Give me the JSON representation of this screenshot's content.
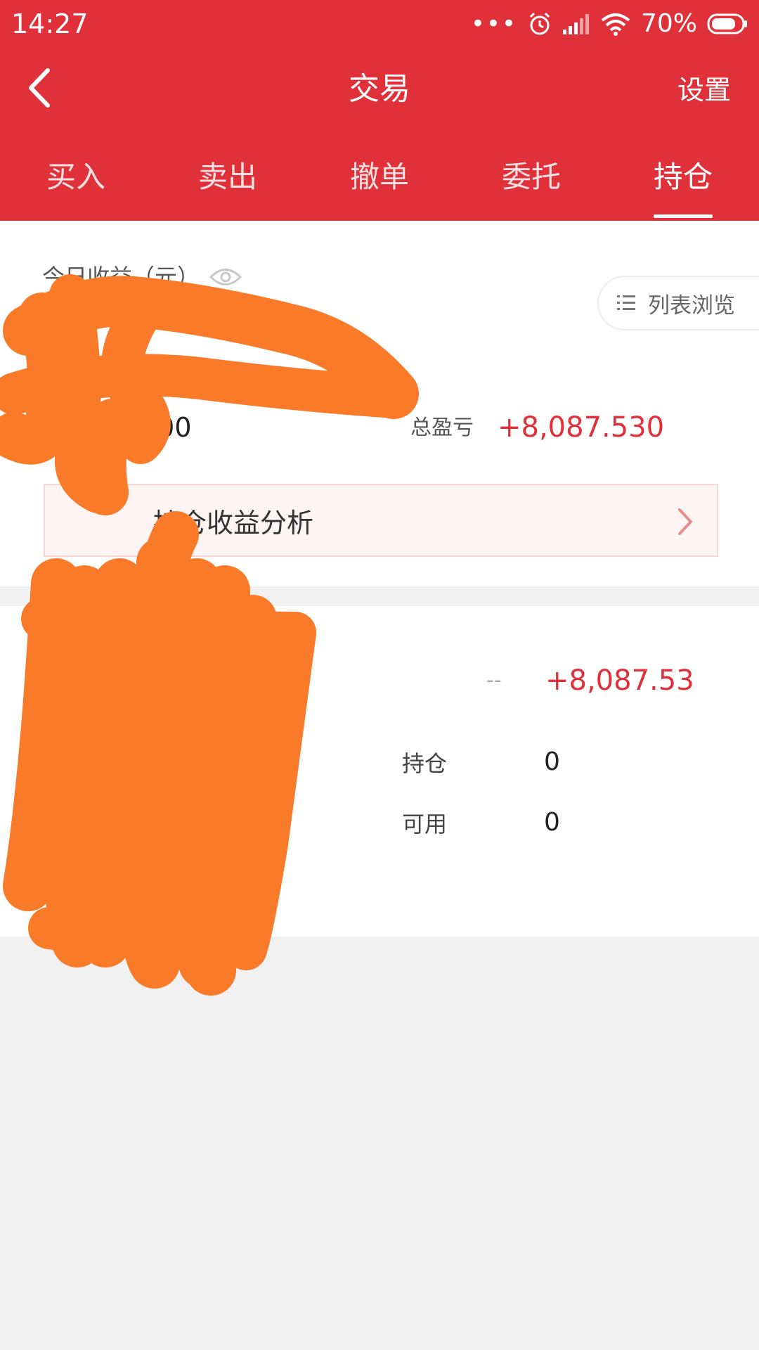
{
  "status_bar": {
    "time": "14:27",
    "dots": "•••",
    "battery_percent": "70%",
    "icons": [
      "alarm-icon",
      "signal-icon",
      "wifi-icon",
      "battery-icon"
    ]
  },
  "nav": {
    "title": "交易",
    "settings_label": "设置",
    "back_icon": "back-arrow-icon"
  },
  "tabs": [
    {
      "label": "买入",
      "active": false
    },
    {
      "label": "卖出",
      "active": false
    },
    {
      "label": "撤单",
      "active": false
    },
    {
      "label": "委托",
      "active": false
    },
    {
      "label": "持仓",
      "active": true
    }
  ],
  "summary": {
    "today_label": "今日收益（元）",
    "eye_icon": "eye-icon",
    "list_view_label": "列表浏览",
    "list_icon": "list-icon",
    "left_value_visible": "000",
    "total_pl_label": "总盈亏",
    "total_pl_value": "+8,087.530",
    "analysis_label": "持仓收益分析"
  },
  "holding": {
    "dash": "--",
    "pl_value": "+8,087.53",
    "position_label": "持仓",
    "position_value": "0",
    "available_label": "可用",
    "available_value": "0"
  },
  "colors": {
    "brand_red": "#e0303a",
    "scribble_orange": "#f97a28",
    "background": "#f1f1f1"
  }
}
